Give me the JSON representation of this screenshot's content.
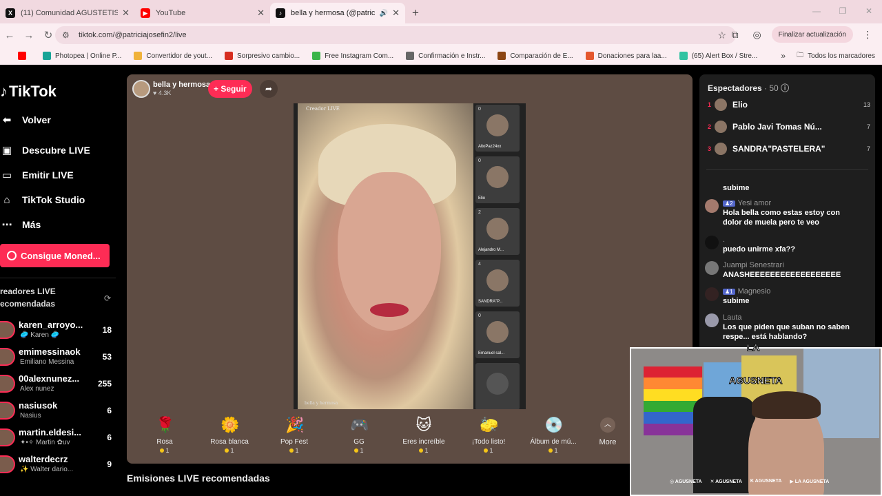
{
  "browser": {
    "tabs": [
      {
        "title": "(11) Comunidad AGUSTETISMO",
        "icon": "x-icon",
        "color": "#111111"
      },
      {
        "title": "YouTube",
        "icon": "youtube-icon",
        "color": "#ff0000"
      },
      {
        "title": "bella y hermosa (@patricia",
        "icon": "tiktok-icon",
        "color": "#111111"
      }
    ],
    "url": "tiktok.com/@patriciajosefin2/live",
    "update_button": "Finalizar actualización",
    "bookmarks": [
      {
        "label": "",
        "color": "#ff0000"
      },
      {
        "label": "Photopea | Online P...",
        "color": "#18a497"
      },
      {
        "label": "Convertidor de yout...",
        "color": "#f0b23a"
      },
      {
        "label": "Sorpresivo cambio...",
        "color": "#d62d20"
      },
      {
        "label": "Free Instagram Com...",
        "color": "#3bb54a"
      },
      {
        "label": "Confirmación e Instr...",
        "color": "#666666"
      },
      {
        "label": "Comparación de E...",
        "color": "#8b4513"
      },
      {
        "label": "Donaciones para laa...",
        "color": "#e4572e"
      },
      {
        "label": "(65) Alert Box / Stre...",
        "color": "#31c3a2"
      }
    ],
    "all_bookmarks": "Todos los marcadores"
  },
  "nav": {
    "logo": "TikTok",
    "back": "Volver",
    "discover": "Descubre LIVE",
    "go_live": "Emitir LIVE",
    "studio": "TikTok Studio",
    "more": "Más",
    "coins": "Consigue Moned...",
    "recommended_title": "readores LIVE ecomendadas"
  },
  "creators": [
    {
      "name": "karen_arroyo...",
      "sub": "🥏 Karen 🥏",
      "count": "18"
    },
    {
      "name": "emimessinaok",
      "sub": "Emiliano Messina",
      "count": "53"
    },
    {
      "name": "00alexnunez...",
      "sub": "Alex nunez",
      "count": "255"
    },
    {
      "name": "nasiusok",
      "sub": "Nasius",
      "count": "6"
    },
    {
      "name": "martin.eldesi...",
      "sub": "✦•✧ Martin ✿uv",
      "count": "6"
    },
    {
      "name": "walterdecrz",
      "sub": "✨ Walter dario...",
      "count": "9"
    }
  ],
  "host": {
    "name": "bella y hermosa",
    "likes": "4.3K",
    "follow": "+ Seguir"
  },
  "video": {
    "creator_label": "Creador LIVE",
    "watermark": "bella y hermosa"
  },
  "guests": [
    {
      "name": "AltoPaz24xx",
      "count": "0"
    },
    {
      "name": "Elio",
      "count": "0"
    },
    {
      "name": "Alejandro M...",
      "count": "2"
    },
    {
      "name": "SANDRA\"P...",
      "count": "4"
    },
    {
      "name": "Emanuel sal...",
      "count": "0"
    }
  ],
  "gifts": [
    {
      "name": "Rosa",
      "price": "1",
      "icon": "🌹"
    },
    {
      "name": "Rosa blanca",
      "price": "1",
      "icon": "🌼"
    },
    {
      "name": "Pop Fest",
      "price": "1",
      "icon": "🎉"
    },
    {
      "name": "GG",
      "price": "1",
      "icon": "🎮"
    },
    {
      "name": "Eres increíble",
      "price": "1",
      "icon": "🐱"
    },
    {
      "name": "¡Todo listo!",
      "price": "1",
      "icon": "🧽"
    },
    {
      "name": "Álbum de mú...",
      "price": "1",
      "icon": "💿"
    }
  ],
  "gifts_more": "More",
  "recommended_bottom": "Emisiones LIVE recomendadas",
  "viewers": {
    "title": "Espectadores",
    "count": "· 50",
    "ranking": [
      {
        "rank": "1",
        "name": "Elio",
        "score": "13"
      },
      {
        "rank": "2",
        "name": "Pablo Javi Tomas Nú...",
        "score": "7"
      },
      {
        "rank": "3",
        "name": "SANDRA\"PASTELERA\"",
        "score": "7"
      }
    ]
  },
  "chat": [
    {
      "user": "",
      "badge": "",
      "text": "subime"
    },
    {
      "user": "Yesi amor",
      "badge": "2",
      "text": "Hola bella como estas estoy con dolor de muela pero te veo"
    },
    {
      "user": ".",
      "badge": "",
      "text": "puedo unirme xfa??"
    },
    {
      "user": "Juampi Senestrari",
      "badge": "",
      "text": "ANASHEEEEEEEEEEEEEEEEEE"
    },
    {
      "user": "Magnesio",
      "badge": "1",
      "text": "subime"
    },
    {
      "user": "Lauta",
      "badge": "",
      "text": "Los que piden que suban no saben respe... está hablando?"
    }
  ],
  "cam": {
    "logo": "LA AGUSNETA",
    "socials": [
      "AGUSNETA",
      "AGUSNETA",
      "AGUSNETA",
      "LA AGUSNETA"
    ]
  }
}
